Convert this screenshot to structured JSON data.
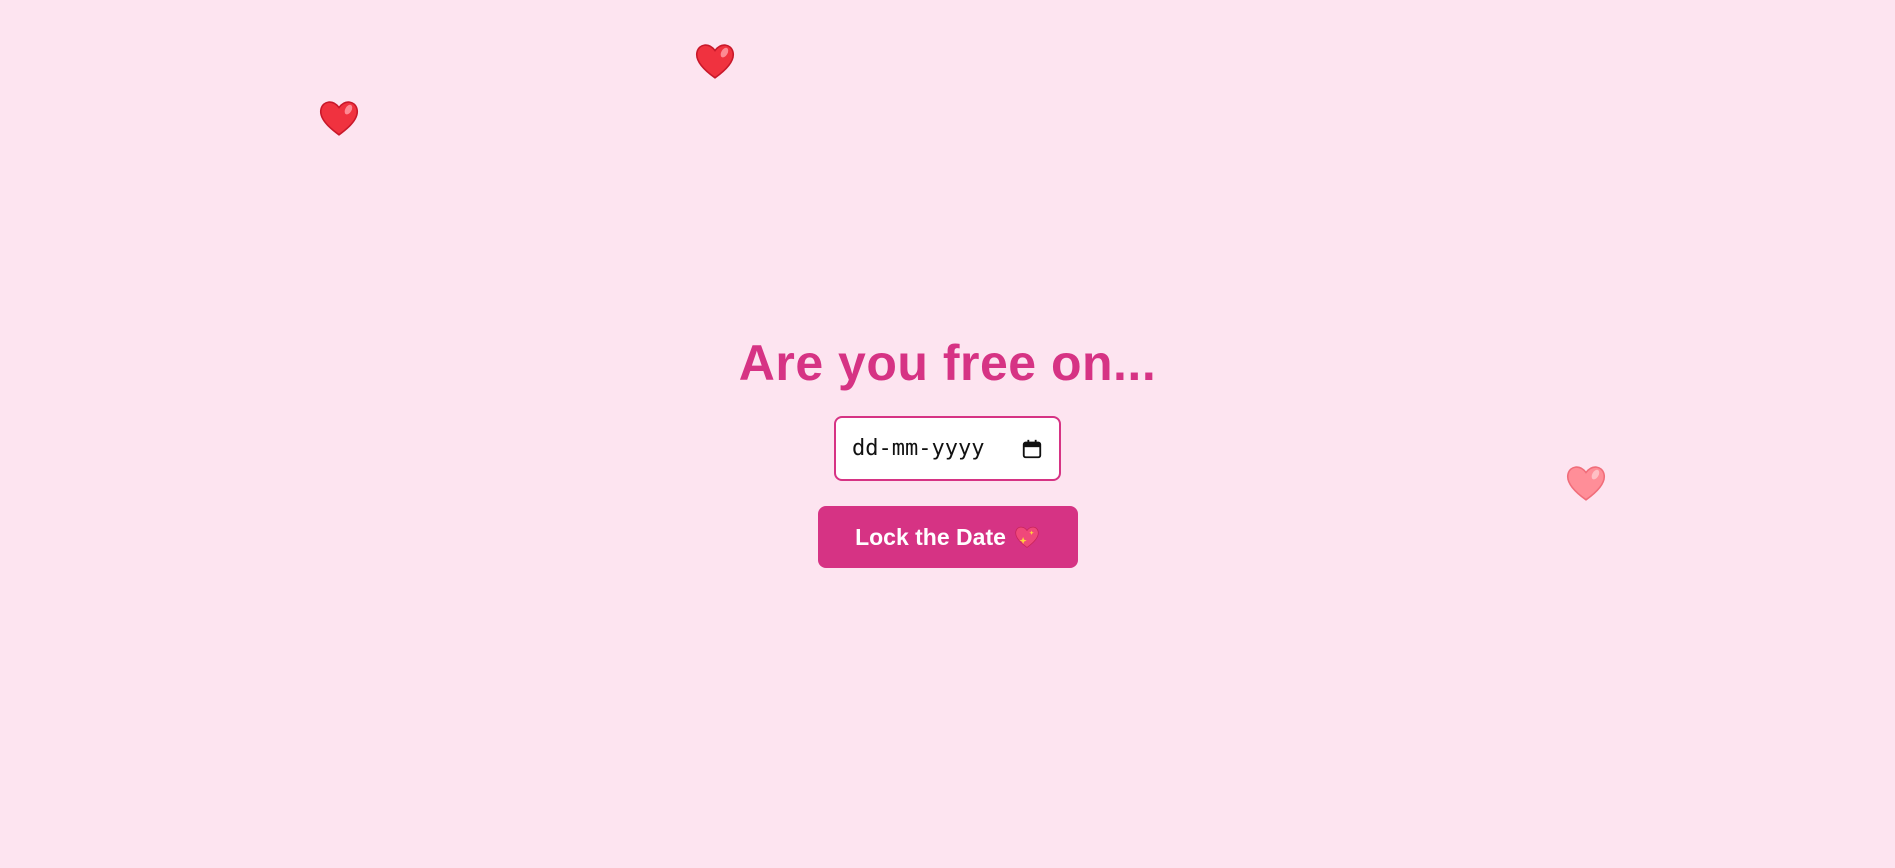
{
  "heading": "Are you free on...",
  "date_input": {
    "placeholder": "dd-mm-yyyy",
    "value": ""
  },
  "lock_button": {
    "label": "Lock the Date",
    "icon": "sparkling-heart-icon"
  },
  "decorations": {
    "icons": [
      "red-heart-icon",
      "red-heart-icon",
      "pink-heart-icon"
    ]
  },
  "colors": {
    "background": "#fde4f0",
    "accent": "#d63384",
    "heart_red": "#f0323f",
    "heart_pink": "#ff8e98"
  }
}
